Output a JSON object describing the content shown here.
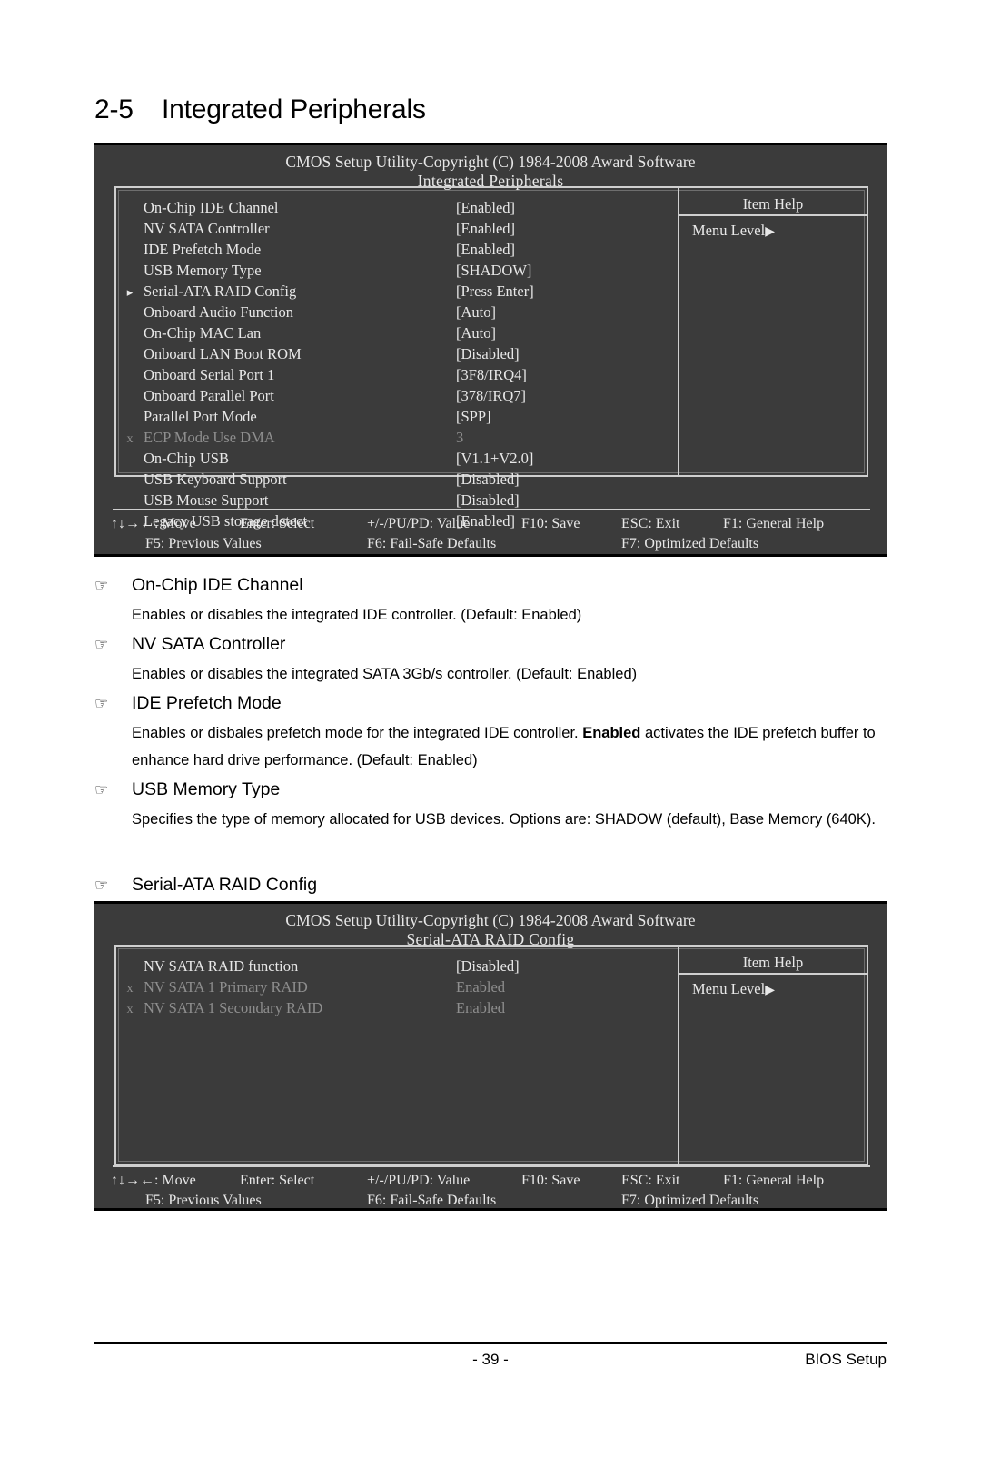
{
  "section": {
    "number": "2-5",
    "title": "Integrated Peripherals"
  },
  "bios_screen_1": {
    "title": "CMOS Setup Utility-Copyright (C) 1984-2008 Award Software",
    "subtitle": "Integrated Peripherals",
    "help_title": "Item Help",
    "help_text": "Menu Level",
    "help_arrow": "▶",
    "submenu_arrow": "▸",
    "disabled_mark": "x",
    "options": [
      {
        "mark": "",
        "label": "On-Chip IDE Channel",
        "value": "[Enabled]",
        "greyed": false
      },
      {
        "mark": "",
        "label": "NV SATA Controller",
        "value": "[Enabled]",
        "greyed": false
      },
      {
        "mark": "",
        "label": "IDE Prefetch Mode",
        "value": "[Enabled]",
        "greyed": false
      },
      {
        "mark": "",
        "label": "USB Memory Type",
        "value": "[SHADOW]",
        "greyed": false
      },
      {
        "mark": "▸",
        "label": "Serial-ATA RAID Config",
        "value": "[Press Enter]",
        "greyed": false
      },
      {
        "mark": "",
        "label": "Onboard Audio Function",
        "value": "[Auto]",
        "greyed": false
      },
      {
        "mark": "",
        "label": "On-Chip MAC Lan",
        "value": "[Auto]",
        "greyed": false
      },
      {
        "mark": "",
        "label": "Onboard LAN Boot ROM",
        "value": "[Disabled]",
        "greyed": false
      },
      {
        "mark": "",
        "label": "Onboard Serial Port 1",
        "value": "[3F8/IRQ4]",
        "greyed": false
      },
      {
        "mark": "",
        "label": "Onboard Parallel Port",
        "value": "[378/IRQ7]",
        "greyed": false
      },
      {
        "mark": "",
        "label": "Parallel Port Mode",
        "value": "[SPP]",
        "greyed": false
      },
      {
        "mark": "x",
        "label": "ECP Mode Use DMA",
        "value": "3",
        "greyed": true
      },
      {
        "mark": "",
        "label": "On-Chip USB",
        "value": "[V1.1+V2.0]",
        "greyed": false
      },
      {
        "mark": "",
        "label": "USB Keyboard Support",
        "value": "[Disabled]",
        "greyed": false
      },
      {
        "mark": "",
        "label": "USB Mouse Support",
        "value": "[Disabled]",
        "greyed": false
      },
      {
        "mark": "",
        "label": "Legacy USB storage detect",
        "value": "[Enabled]",
        "greyed": false
      }
    ],
    "footer": {
      "row1": [
        "↑↓→←: Move",
        "Enter: Select",
        "+/-/PU/PD: Value",
        "F10: Save",
        "ESC: Exit",
        "F1: General Help"
      ],
      "row2": [
        "F5: Previous Values",
        "F6: Fail-Safe Defaults",
        "F7: Optimized Defaults"
      ]
    }
  },
  "bios_screen_2": {
    "title": "CMOS Setup Utility-Copyright (C) 1984-2008 Award Software",
    "subtitle": "Serial-ATA RAID Config",
    "help_title": "Item Help",
    "help_text": "Menu Level",
    "help_arrow": "▶",
    "options": [
      {
        "mark": "",
        "label": "NV SATA RAID function",
        "value": "[Disabled]",
        "greyed": false
      },
      {
        "mark": "x",
        "label": "NV SATA 1 Primary RAID",
        "value": "Enabled",
        "greyed": true
      },
      {
        "mark": "x",
        "label": "NV SATA 1 Secondary RAID",
        "value": "Enabled",
        "greyed": true
      }
    ],
    "footer": {
      "row1": [
        "↑↓→←: Move",
        "Enter: Select",
        "+/-/PU/PD: Value",
        "F10: Save",
        "ESC: Exit",
        "F1: General Help"
      ],
      "row2": [
        "F5: Previous Values",
        "F6: Fail-Safe Defaults",
        "F7: Optimized Defaults"
      ]
    }
  },
  "hand_glyph": "☞",
  "items": [
    {
      "heading": "On-Chip IDE Channel",
      "paragraph_pre": "Enables or disables the integrated IDE controller. (Default: Enabled)",
      "paragraph_bold": "",
      "paragraph_post": ""
    },
    {
      "heading": "NV SATA Controller",
      "paragraph_pre": "Enables or disables the integrated SATA 3Gb/s controller. (Default: Enabled)",
      "paragraph_bold": "",
      "paragraph_post": ""
    },
    {
      "heading": "IDE Prefetch Mode",
      "paragraph_pre": "Enables or disbales prefetch mode for the integrated IDE controller. ",
      "paragraph_bold": "Enabled",
      "paragraph_post": " activates the IDE prefetch buffer to enhance hard drive performance.  (Default: Enabled)"
    },
    {
      "heading": "USB Memory Type",
      "paragraph_pre": "Specifies the type of memory allocated for USB devices. Options are: SHADOW (default), Base Memory (640K).",
      "paragraph_bold": "",
      "paragraph_post": ""
    },
    {
      "heading": "Serial-ATA RAID Config",
      "paragraph_pre": "",
      "paragraph_bold": "",
      "paragraph_post": ""
    }
  ],
  "page_footer": {
    "page_number": "- 39 -",
    "right_label": "BIOS Setup"
  }
}
